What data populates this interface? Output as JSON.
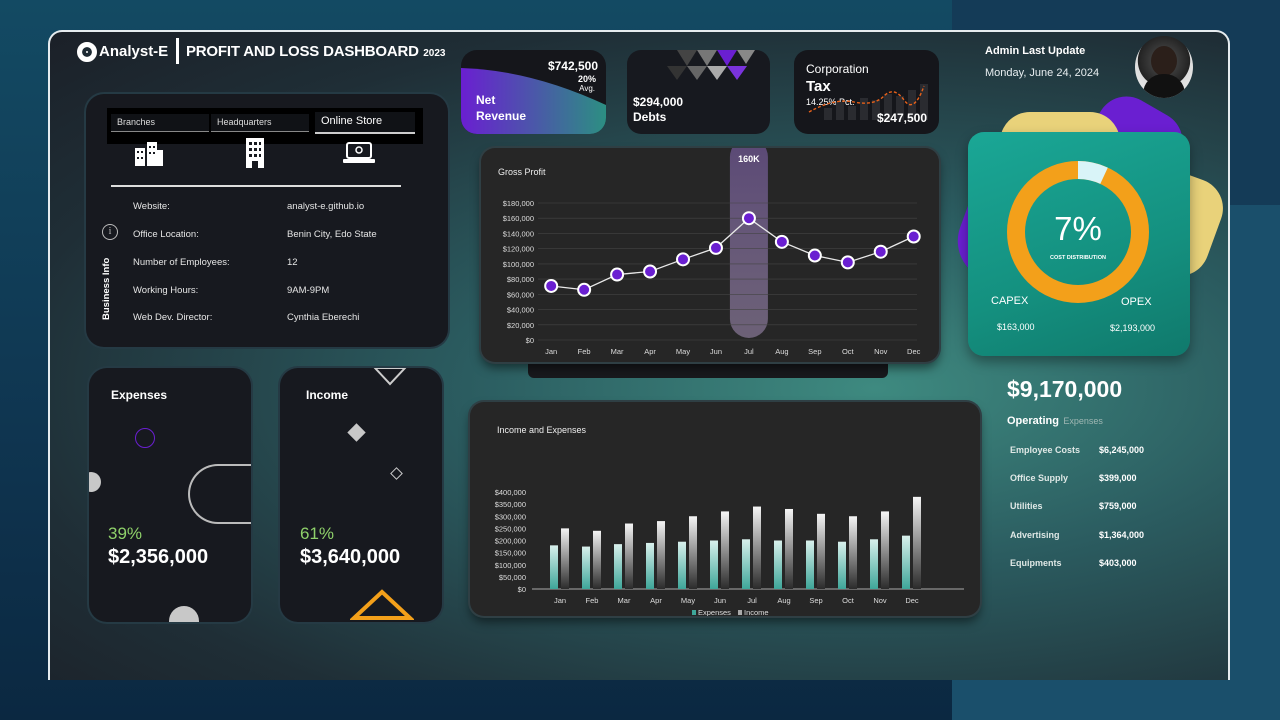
{
  "header": {
    "brand": "Analyst-E",
    "title": "PROFIT AND LOSS DASHBOARD",
    "year": "2023"
  },
  "kpis": {
    "net_revenue": {
      "value": "$742,500",
      "pct": "20%",
      "pct_label": "Avg.",
      "label_line1": "Net",
      "label_line2": "Revenue"
    },
    "debts": {
      "value": "$294,000",
      "label": "Debts"
    },
    "tax": {
      "label_line1": "Corporation",
      "label_line2": "Tax",
      "pct": "14.25% Pct.",
      "value": "$247,500"
    }
  },
  "admin": {
    "label": "Admin Last Update",
    "date": "Monday, June 24, 2024"
  },
  "business_info": {
    "tabs": [
      "Branches",
      "Headquarters",
      "Online Store"
    ],
    "active_tab": 2,
    "section_label": "Business Info",
    "rows": [
      {
        "label": "Website:",
        "value": "analyst-e.github.io"
      },
      {
        "label": "Office Location:",
        "value": "Benin City, Edo State"
      },
      {
        "label": "Number of Employees:",
        "value": "12"
      },
      {
        "label": "Working Hours:",
        "value": "9AM-9PM"
      },
      {
        "label": "Web Dev. Director:",
        "value": "Cynthia Eberechi"
      }
    ]
  },
  "expenses_card": {
    "label": "Expenses",
    "pct": "39%",
    "value": "$2,356,000"
  },
  "income_card": {
    "label": "Income",
    "pct": "61%",
    "value": "$3,640,000"
  },
  "cost_distribution": {
    "pct": "7%",
    "caption": "COST DISTRIBUTION",
    "capex_label": "CAPEX",
    "capex_value": "$163,000",
    "opex_label": "OPEX",
    "opex_value": "$2,193,000",
    "capex_fraction": 0.069
  },
  "operating": {
    "total": "$9,170,000",
    "label_bold": "Operating",
    "label_light": "Expenses",
    "rows": [
      {
        "label": "Employee Costs",
        "value": "$6,245,000"
      },
      {
        "label": "Office Supply",
        "value": "$399,000"
      },
      {
        "label": "Utilities",
        "value": "$759,000"
      },
      {
        "label": "Advertising",
        "value": "$1,364,000"
      },
      {
        "label": "Equipments",
        "value": "$403,000"
      }
    ]
  },
  "colors": {
    "purple": "#6a1fd1",
    "orange": "#f3a01a",
    "teal": "#1a9c8c",
    "green_pct": "#8fd16a"
  },
  "chart_data": [
    {
      "type": "line",
      "title": "Gross Profit",
      "categories": [
        "Jan",
        "Feb",
        "Mar",
        "Apr",
        "May",
        "Jun",
        "Jul",
        "Aug",
        "Sep",
        "Oct",
        "Nov",
        "Dec"
      ],
      "values": [
        71000,
        66000,
        86000,
        90000,
        106000,
        121000,
        160000,
        129000,
        111000,
        102000,
        116000,
        136000
      ],
      "highlight_label": "160K",
      "highlight_index": 6,
      "yticks": [
        "$0",
        "$20,000",
        "$40,000",
        "$60,000",
        "$80,000",
        "$100,000",
        "$120,000",
        "$140,000",
        "$160,000",
        "$180,000"
      ],
      "ylim": [
        0,
        180000
      ],
      "grid": true
    },
    {
      "type": "bar",
      "title": "Income and Expenses",
      "categories": [
        "Jan",
        "Feb",
        "Mar",
        "Apr",
        "May",
        "Jun",
        "Jul",
        "Aug",
        "Sep",
        "Oct",
        "Nov",
        "Dec"
      ],
      "series": [
        {
          "name": "Expenses",
          "values": [
            180000,
            175000,
            185000,
            190000,
            195000,
            200000,
            205000,
            200000,
            200000,
            195000,
            205000,
            220000
          ]
        },
        {
          "name": "Income",
          "values": [
            250000,
            240000,
            270000,
            280000,
            300000,
            320000,
            340000,
            330000,
            310000,
            300000,
            320000,
            380000
          ]
        }
      ],
      "yticks": [
        "$0",
        "$50,000",
        "$100,000",
        "$150,000",
        "$200,000",
        "$250,000",
        "$300,000",
        "$350,000",
        "$400,000"
      ],
      "ylim": [
        0,
        400000
      ],
      "legend": "bottom"
    }
  ]
}
